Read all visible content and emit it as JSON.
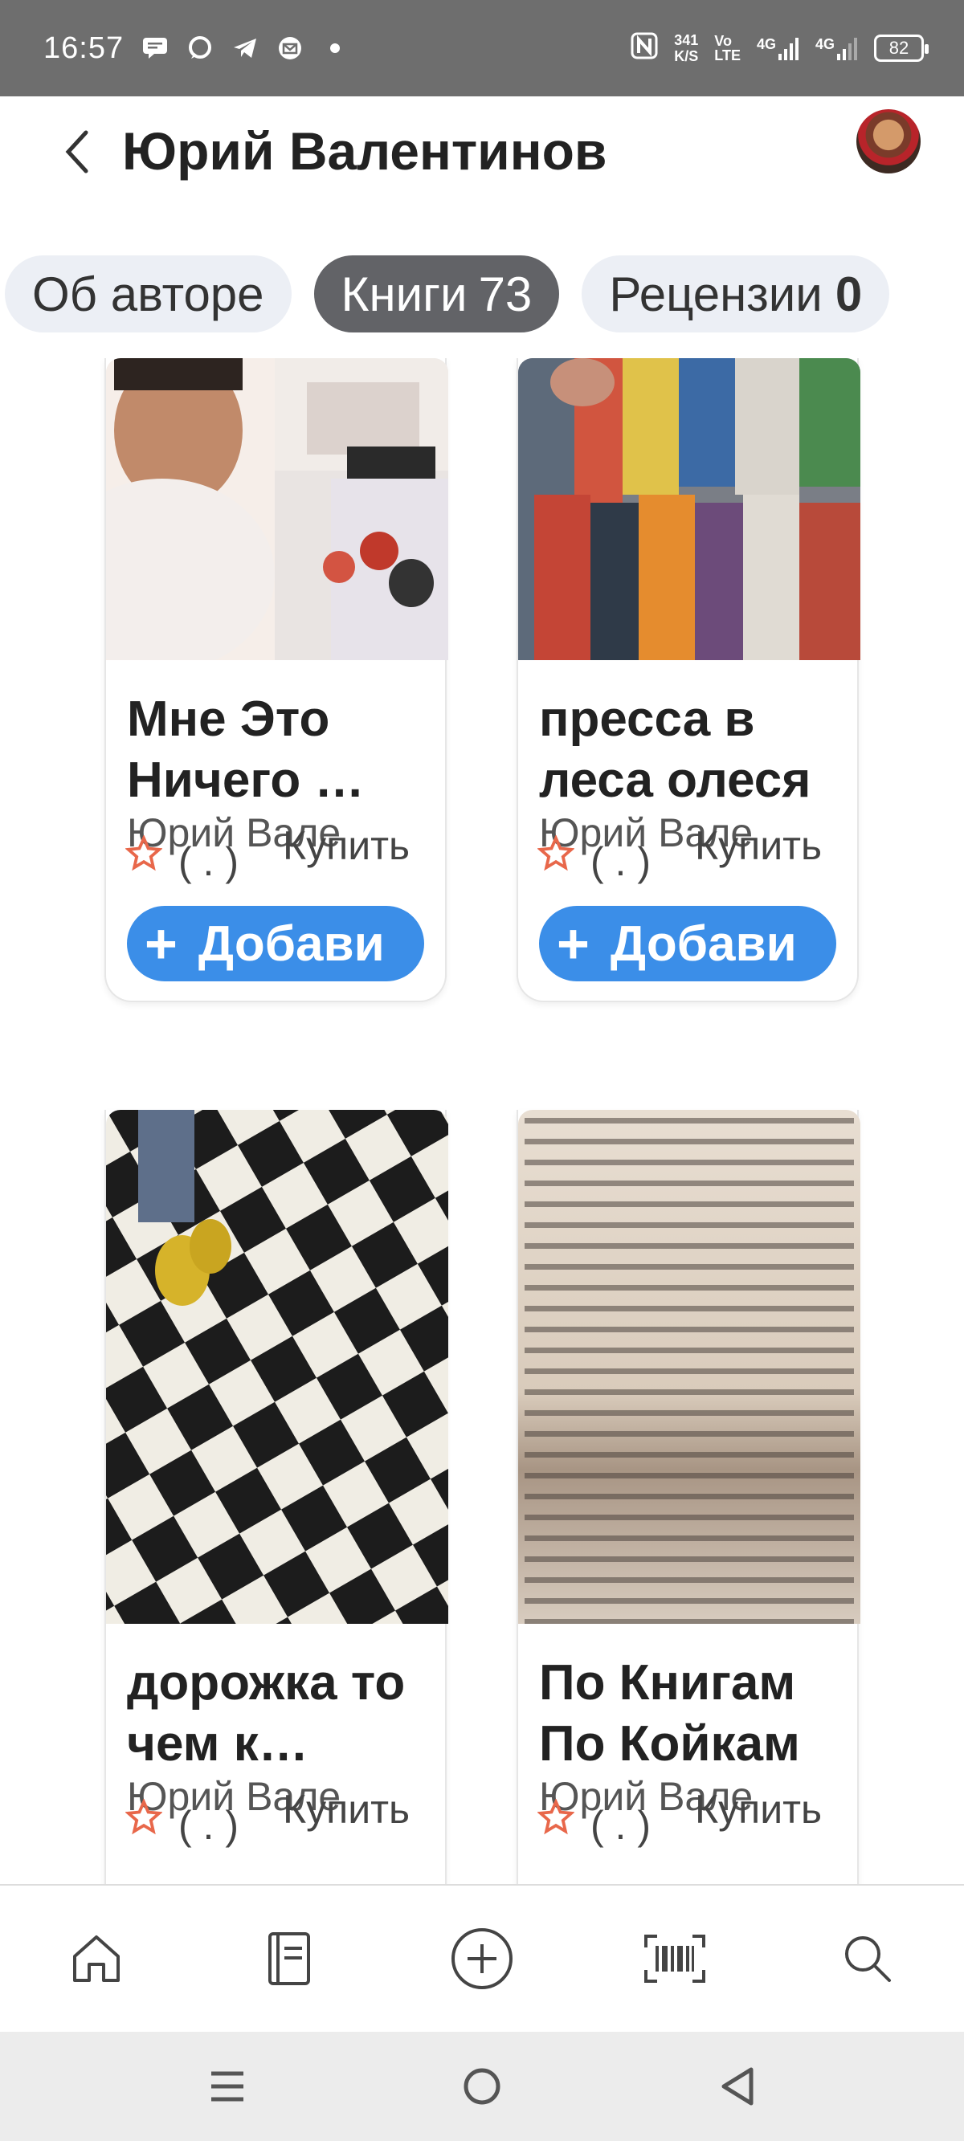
{
  "status_bar": {
    "time": "16:57",
    "speed_value": "341",
    "speed_unit": "K/S",
    "vo_lte": [
      "Vo",
      "LTE"
    ],
    "signal_1": "4G",
    "signal_2": "4G",
    "battery": "82"
  },
  "header": {
    "title": "Юрий Валентинов"
  },
  "tabs": [
    {
      "label": "Об авторе",
      "count": ""
    },
    {
      "label": "Книги",
      "count": "73"
    },
    {
      "label": "Рецензии",
      "count": "0"
    }
  ],
  "books": [
    {
      "title": "Мне Это Ничего …",
      "author": "Юрий Вале",
      "rating": "( . )",
      "buy": "Купить",
      "add": "Добави"
    },
    {
      "title": "пресса в леса олеся",
      "author": "Юрий Вале",
      "rating": "( . )",
      "buy": "Купить",
      "add": "Добави"
    },
    {
      "title": "дорожка то чем к…",
      "author": "Юрий Вале",
      "rating": "( . )",
      "buy": "Купить",
      "add": ""
    },
    {
      "title": "По Книгам По Койкам",
      "author": "Юрий Вале",
      "rating": "( . )",
      "buy": "Купить",
      "add": ""
    }
  ],
  "colors": {
    "accent": "#3b8ee8",
    "active_tab": "#626367",
    "star": "#e8674a"
  }
}
